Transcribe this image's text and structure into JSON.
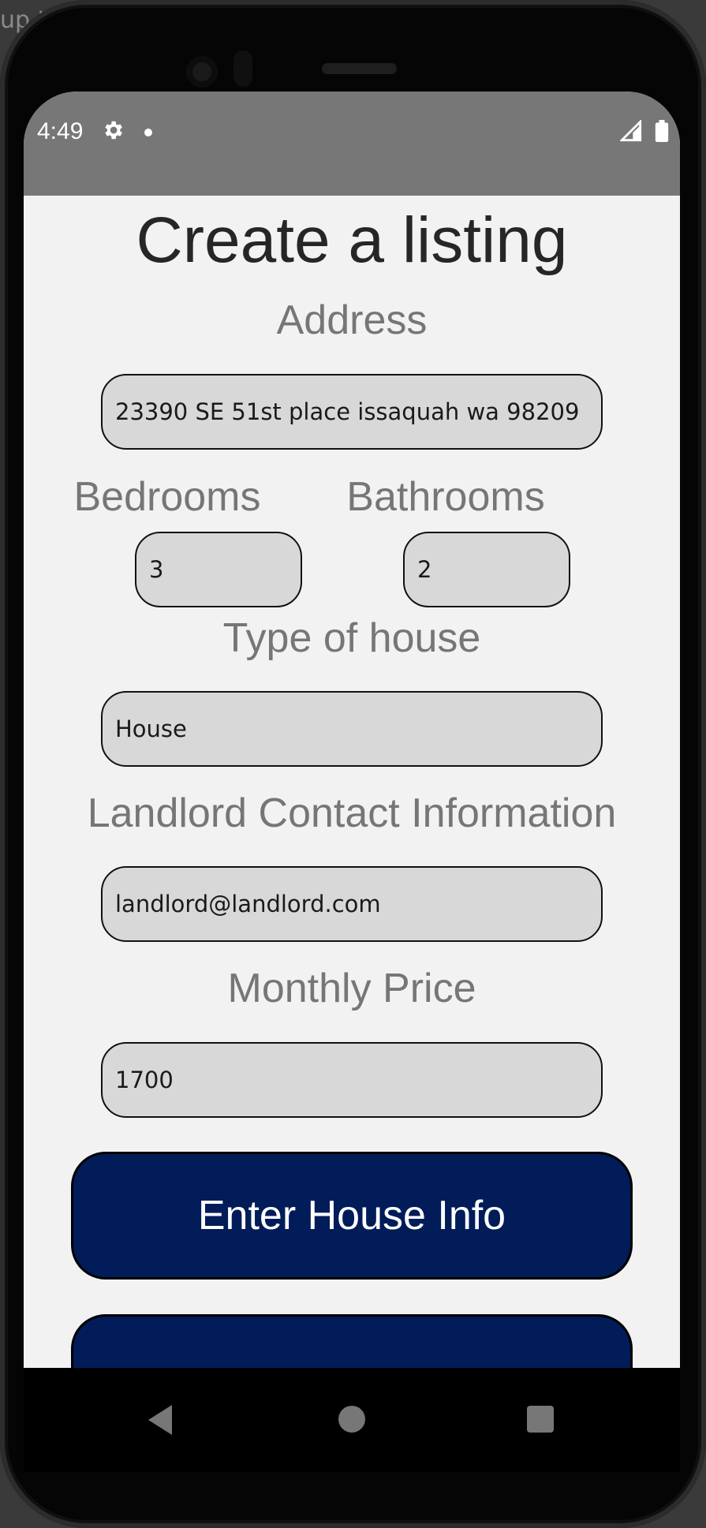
{
  "background_text": "up.t",
  "status_bar": {
    "time": "4:49"
  },
  "page": {
    "title": "Create a listing"
  },
  "form": {
    "address": {
      "label": "Address",
      "value": "23390 SE 51st place issaquah wa 98209"
    },
    "bedrooms": {
      "label": "Bedrooms",
      "value": "3"
    },
    "bathrooms": {
      "label": "Bathrooms",
      "value": "2"
    },
    "house_type": {
      "label": "Type of house",
      "value": "House"
    },
    "contact": {
      "label": "Landlord Contact Information",
      "value": "landlord@landlord.com"
    },
    "price": {
      "label": "Monthly Price",
      "value": "1700"
    }
  },
  "buttons": {
    "enter_label": "Enter House Info",
    "second_label": ""
  },
  "colors": {
    "button": "#021c59",
    "field": "#d8d8d8",
    "label": "#767676",
    "screen": "#f2f2f2",
    "status_bar": "#777777"
  },
  "icons": {
    "status": [
      "gear-icon",
      "notification-dot-icon",
      "signal-icon",
      "battery-icon"
    ],
    "nav": [
      "back-icon",
      "home-icon",
      "recents-icon"
    ]
  }
}
